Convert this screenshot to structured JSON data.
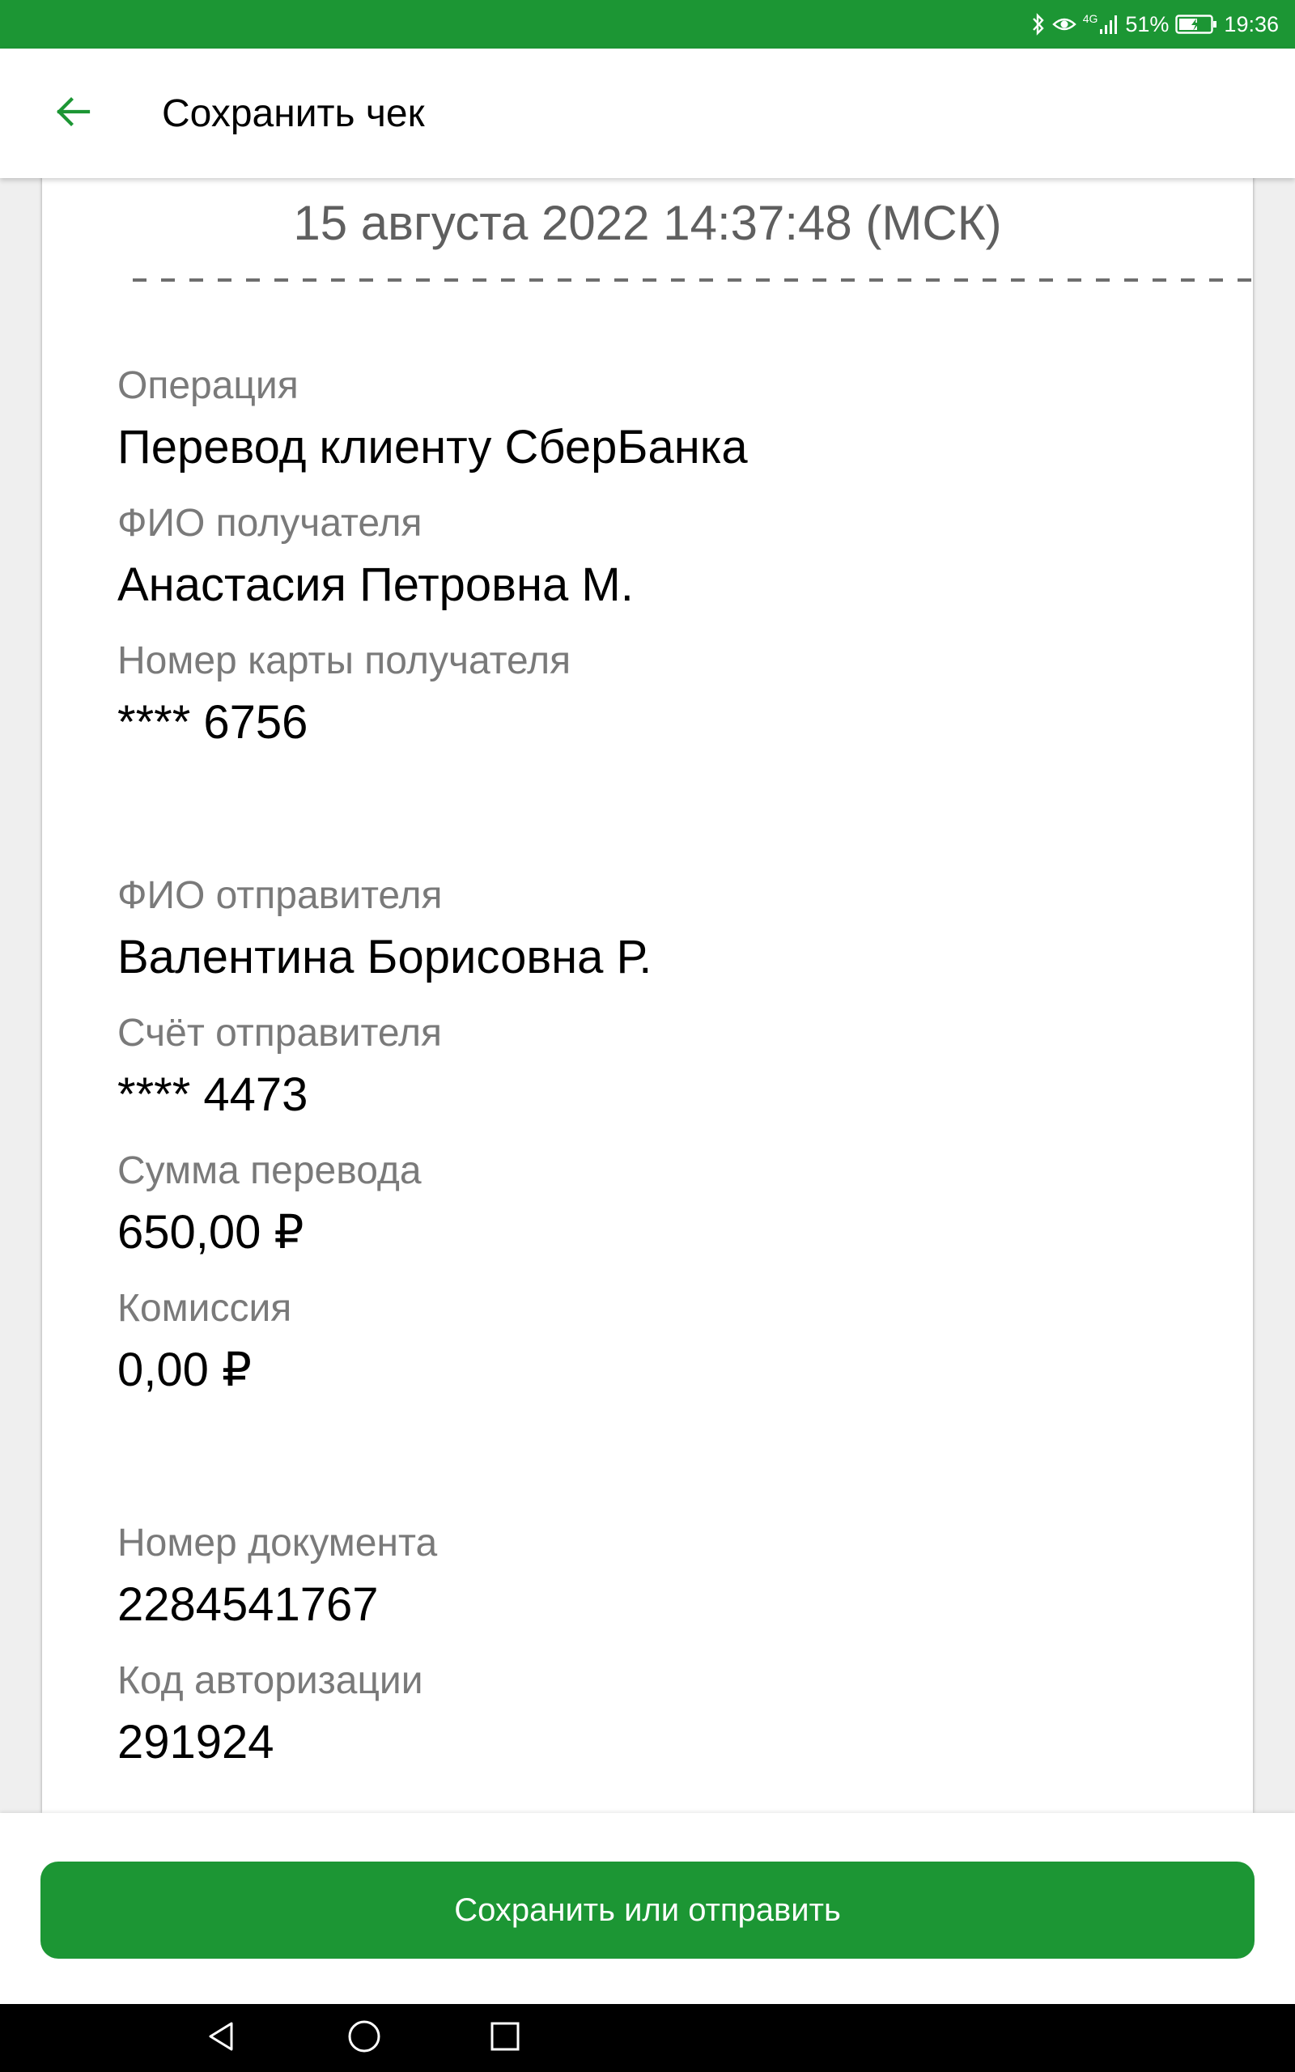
{
  "status_bar": {
    "network": "4G",
    "battery": "51%",
    "time": "19:36",
    "icons": [
      "bluetooth-icon",
      "eye-icon",
      "signal-icon",
      "battery-icon"
    ]
  },
  "header": {
    "title": "Сохранить чек",
    "back_icon": "arrow-left-icon"
  },
  "receipt": {
    "datetime": "15 августа 2022 14:37:48 (МСК)",
    "fields": [
      {
        "label": "Операция",
        "value": "Перевод клиенту СберБанка"
      },
      {
        "label": "ФИО получателя",
        "value": "Анастасия Петровна М."
      },
      {
        "label": "Номер карты получателя",
        "value": "**** 6756"
      },
      {
        "label": "ФИО отправителя",
        "value": "Валентина Борисовна Р."
      },
      {
        "label": "Счёт отправителя",
        "value": "**** 4473"
      },
      {
        "label": "Сумма перевода",
        "value": "650,00 ₽"
      },
      {
        "label": "Комиссия",
        "value": "0,00 ₽"
      },
      {
        "label": "Номер документа",
        "value": "2284541767"
      },
      {
        "label": "Код авторизации",
        "value": "291924"
      }
    ]
  },
  "actions": {
    "save_or_send": "Сохранить или отправить"
  },
  "system_nav": [
    "back-triangle-icon",
    "home-circle-icon",
    "recents-square-icon"
  ],
  "colors": {
    "brand_green": "#1c9634",
    "label_gray": "#7a7a7a",
    "date_gray": "#5f5f5f"
  }
}
